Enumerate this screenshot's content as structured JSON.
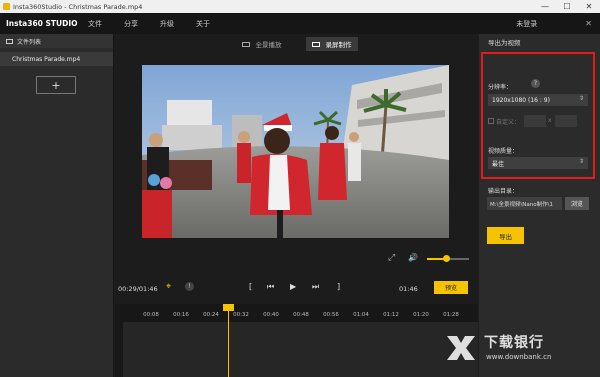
{
  "titlebar": {
    "title": "Insta360Studio - Christmas Parade.mp4",
    "minimize": "—",
    "maximize": "☐",
    "close": "✕"
  },
  "menubar": {
    "brand": "Insta360 STUDIO",
    "items": [
      "文件",
      "分享",
      "升级",
      "关于"
    ],
    "login": "未登录",
    "close": "✕"
  },
  "sidebar": {
    "header": "文件列表",
    "files": [
      "Christmas Parade.mp4"
    ],
    "add_label": "+"
  },
  "view_tabs": [
    {
      "label": "全景播放",
      "active": false
    },
    {
      "label": "录屏制作",
      "active": true
    }
  ],
  "video_controls": {
    "volume_level": 0.45
  },
  "playback": {
    "current_time": "00:29/01:46",
    "info": "!",
    "mark_in": "[",
    "prev": "⏮",
    "play": "▶",
    "next": "⏭",
    "mark_out": "]",
    "end_time": "01:46",
    "preview_label": "预览"
  },
  "timeline": {
    "ticks": [
      "00:08",
      "00:16",
      "00:24",
      "00:32",
      "00:40",
      "00:48",
      "00:56",
      "01:04",
      "01:12",
      "01:20",
      "01:28"
    ],
    "playhead_time": "00:29"
  },
  "export_panel": {
    "title": "导出为视频",
    "resolution_label": "分辨率：",
    "resolution_help": "?",
    "resolution_value": "1920x1080 (16 : 9)",
    "custom_label": "自定义：",
    "quality_label": "视频质量：",
    "quality_value": "最佳",
    "output_label": "输出目录：",
    "output_path": "M:\\全景视频\\Nano制作\\1",
    "browse_label": "浏览",
    "export_label": "导出"
  },
  "watermark": {
    "text": "下载银行",
    "url": "www.downbank.cn"
  },
  "colors": {
    "accent": "#f5c300",
    "highlight_box": "#e21b1b",
    "panel": "#2b2b2b",
    "background": "#1c1c1c"
  }
}
